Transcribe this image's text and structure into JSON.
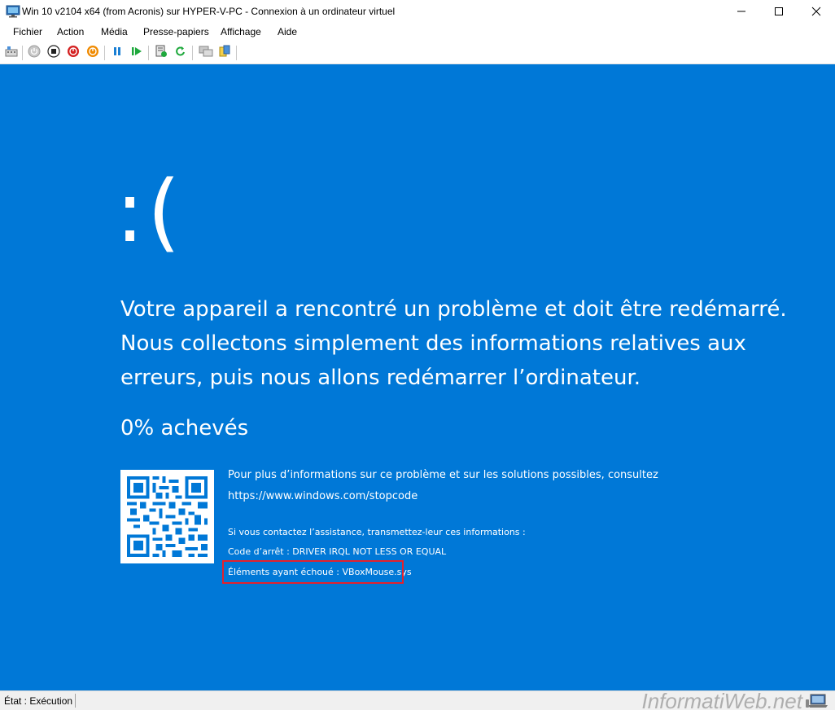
{
  "window": {
    "title": "Win 10 v2104 x64 (from Acronis) sur HYPER-V-PC - Connexion à un ordinateur virtuel"
  },
  "menu": {
    "items": [
      "Fichier",
      "Action",
      "Média",
      "Presse-papiers",
      "Affichage",
      "Aide"
    ]
  },
  "toolbar": {
    "icons": [
      "ctrl-alt-del-icon",
      "start-icon",
      "turn-off-icon",
      "shutdown-icon",
      "save-icon",
      "pause-icon",
      "resume-icon",
      "checkpoint-icon",
      "revert-icon",
      "enhanced-session-icon",
      "share-icon"
    ]
  },
  "bsod": {
    "frown": ":(",
    "message": "Votre appareil a rencontré un problème et doit être redémarré. Nous collectons simplement des informations relatives aux erreurs, puis nous allons redémarrer l’ordinateur.",
    "progress": "0% achevés",
    "info_line1": "Pour plus d’informations sur ce problème et sur les solutions possibles, consultez",
    "info_url": "https://www.windows.com/stopcode",
    "support_line": "Si vous contactez l’assistance, transmettez-leur ces informations :",
    "stop_code": "Code d’arrêt : DRIVER IRQL NOT LESS OR EQUAL",
    "failed_item": "Éléments ayant échoué : VBoxMouse.sys",
    "background_color": "#0078d7",
    "highlight_color": "#e3212d"
  },
  "status": {
    "state": "État : Exécution",
    "watermark": "InformatiWeb.net"
  }
}
